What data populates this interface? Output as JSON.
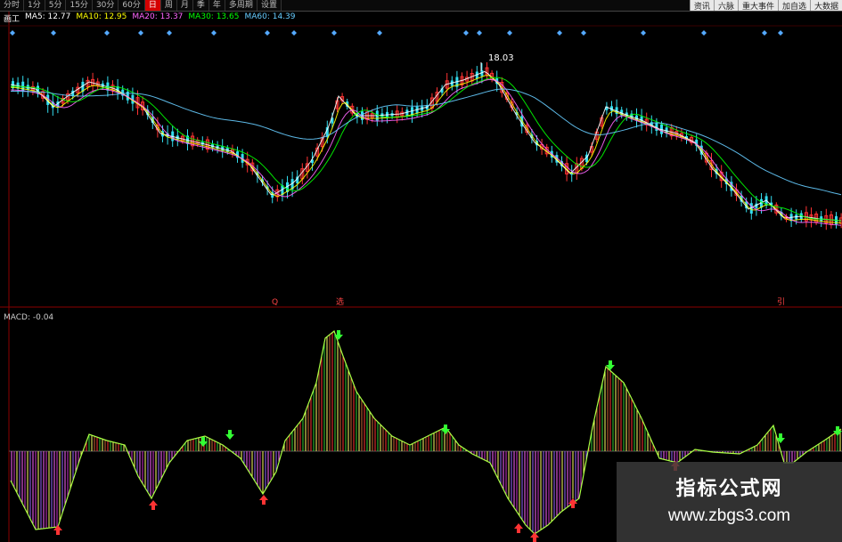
{
  "toolbar": {
    "timeframes": [
      "分时",
      "1分",
      "5分",
      "15分",
      "30分",
      "60分",
      "日",
      "周",
      "月",
      "季",
      "年",
      "多周期",
      "设置"
    ],
    "active_index": 6
  },
  "right_menu": [
    "资讯",
    "六脉",
    "重大事件",
    "加自选",
    "大数据"
  ],
  "ma_legend": [
    {
      "label": "画工",
      "color": "#ffffff"
    },
    {
      "label": "MA5: 12.77",
      "color": "#ffffff"
    },
    {
      "label": "MA10: 12.95",
      "color": "#ffff00"
    },
    {
      "label": "MA20: 13.37",
      "color": "#ff66ff"
    },
    {
      "label": "MA30: 13.65",
      "color": "#00ff00"
    },
    {
      "label": "MA60: 14.39",
      "color": "#66ccff"
    }
  ],
  "price_high_label": "18.03",
  "event_markers": [
    "Q",
    "选",
    "引"
  ],
  "macd_label": "MACD: -0.04",
  "watermark": {
    "title": "指标公式网",
    "url": "www.zbgs3.com"
  },
  "colors": {
    "up": "#ff3333",
    "down": "#33ddee",
    "grid": "#7a0000"
  }
}
